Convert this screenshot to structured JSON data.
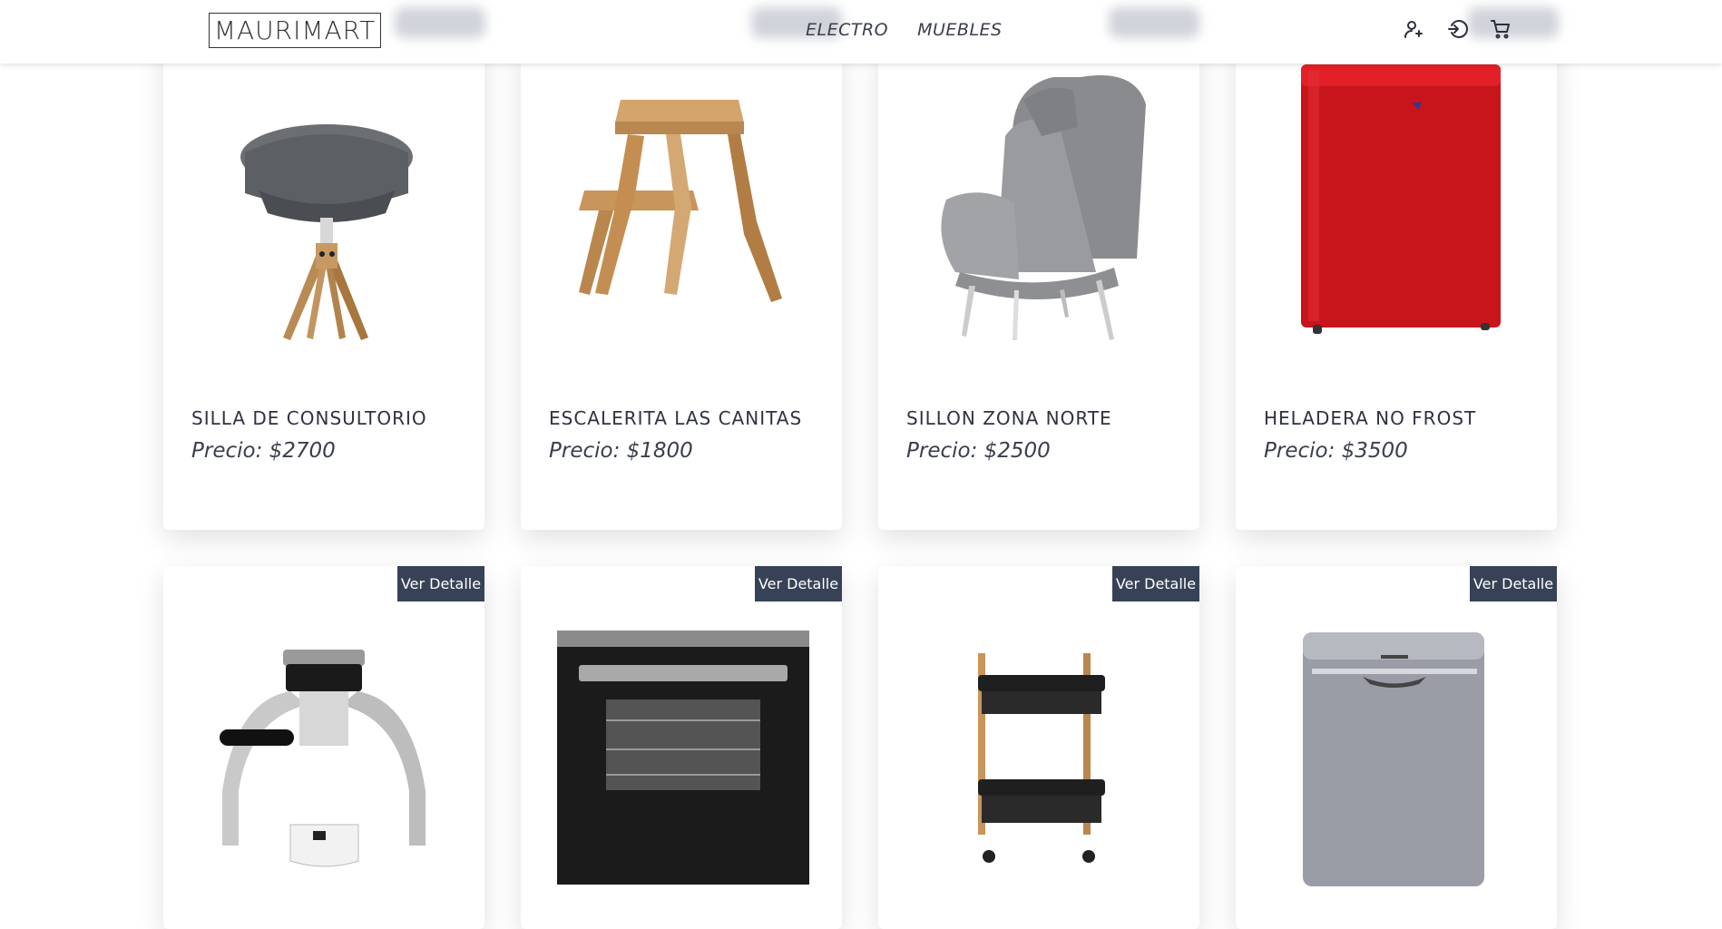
{
  "brand": {
    "logo_text": "MAURIMART"
  },
  "nav": {
    "links": [
      "ELECTRO",
      "MUEBLES"
    ],
    "icons": [
      "user-add-icon",
      "logout-icon",
      "cart-icon"
    ]
  },
  "products": [
    {
      "title": "SILLA DE CONSULTORIO",
      "price": "Precio: $2700",
      "image": "chair-icon"
    },
    {
      "title": "ESCALERITA LAS CANITAS",
      "price": "Precio: $1800",
      "image": "stool-icon"
    },
    {
      "title": "SILLON ZONA NORTE",
      "price": "Precio: $2500",
      "image": "armchair-icon"
    },
    {
      "title": "HELADERA NO FROST",
      "price": "Precio: $3500",
      "image": "fridge-icon"
    },
    {
      "detail_label": "Ver Detalle",
      "image": "espresso-maker-icon"
    },
    {
      "detail_label": "Ver Detalle",
      "image": "oven-icon"
    },
    {
      "detail_label": "Ver Detalle",
      "image": "cart-trolley-icon"
    },
    {
      "detail_label": "Ver Detalle",
      "image": "dryer-icon"
    }
  ],
  "colors": {
    "button_bg": "#374256",
    "text": "#2f3340",
    "fridge_red": "#d0141a"
  }
}
